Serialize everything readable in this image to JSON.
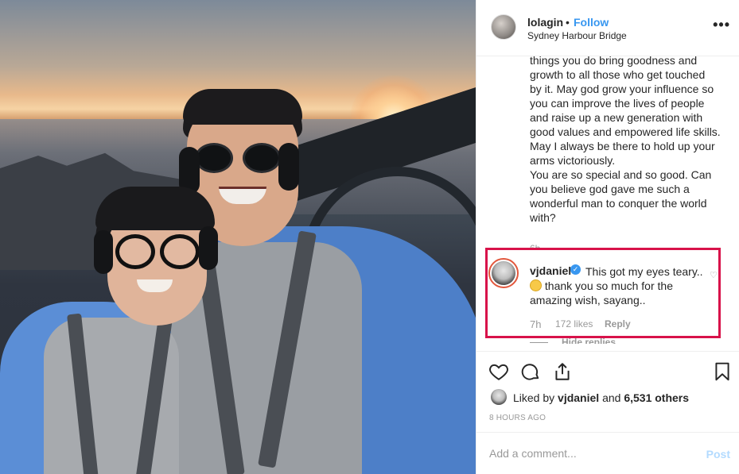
{
  "post": {
    "username": "lolagin",
    "separator": "•",
    "follow_label": "Follow",
    "location": "Sydney Harbour Bridge",
    "more_icon": "more-horizontal-icon"
  },
  "caption": {
    "partial_top": "things you do bring goodness and",
    "lines": [
      "growth to all those who get touched",
      "by it. May god grow your influence so",
      "you can improve the lives of people",
      "and raise up a new generation with",
      "good values and empowered life skills.",
      "May I always be there to hold up your",
      "arms victoriously.",
      "You are so special and so good. Can",
      "you believe god gave me such a",
      "wonderful man to conquer the world",
      "with?"
    ],
    "time": "6h"
  },
  "comment": {
    "username": "vjdaniel",
    "text_before_emoji": "This got my eyes teary.. ",
    "emoji": "crying-face-emoji",
    "text_after_emoji": " thank you so much for the amazing wish, sayang..",
    "time": "7h",
    "likes": "172 likes",
    "reply_label": "Reply",
    "hide_replies_label": "Hide replies",
    "highlight_color": "#d8124a"
  },
  "actions": {
    "icons": [
      "heart-icon",
      "comment-icon",
      "share-icon",
      "bookmark-icon"
    ]
  },
  "likes": {
    "prefix": "Liked by ",
    "user": "vjdaniel",
    "middle": " and ",
    "count": "6,531 others"
  },
  "timestamp": "8 HOURS AGO",
  "add_comment": {
    "placeholder": "Add a comment...",
    "post_label": "Post"
  },
  "colors": {
    "link_blue": "#3897f0",
    "muted_gray": "#999999",
    "post_disabled": "#b3dbff"
  }
}
